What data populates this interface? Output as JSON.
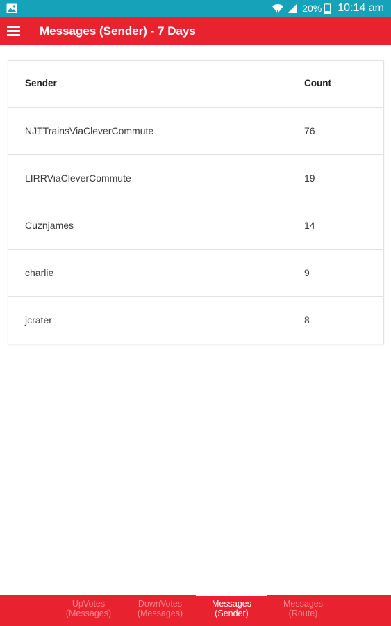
{
  "status_bar": {
    "battery_percent": "20%",
    "time": "10:14 am",
    "icons": [
      "image-icon",
      "wifi-icon",
      "signal-icon",
      "battery-icon"
    ]
  },
  "app_bar": {
    "title": "Messages (Sender) - 7 Days",
    "menu_icon": "hamburger-menu-icon"
  },
  "table": {
    "headers": {
      "sender": "Sender",
      "count": "Count"
    },
    "rows": [
      {
        "sender": "NJTTrainsViaCleverCommute",
        "count": "76"
      },
      {
        "sender": "LIRRViaCleverCommute",
        "count": "19"
      },
      {
        "sender": "Cuznjames",
        "count": "14"
      },
      {
        "sender": "charlie",
        "count": "9"
      },
      {
        "sender": "jcrater",
        "count": "8"
      }
    ]
  },
  "bottom_nav": {
    "tabs": [
      {
        "line1": "UpVotes",
        "line2": "(Messages)",
        "active": false
      },
      {
        "line1": "DownVotes",
        "line2": "(Messages)",
        "active": false
      },
      {
        "line1": "Messages",
        "line2": "(Sender)",
        "active": true
      },
      {
        "line1": "Messages",
        "line2": "(Route)",
        "active": false
      }
    ]
  },
  "colors": {
    "status_bar": "#16a2b8",
    "primary_red": "#e8222f",
    "divider": "#e2e2e2"
  }
}
